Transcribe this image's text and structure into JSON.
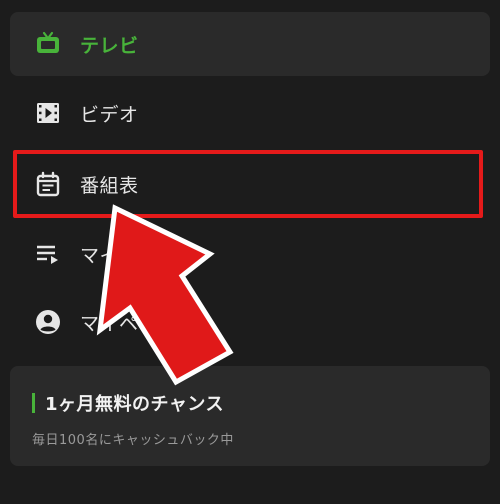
{
  "nav": {
    "items": [
      {
        "label": "テレビ",
        "icon": "tv-icon",
        "active": true
      },
      {
        "label": "ビデオ",
        "icon": "video-icon",
        "active": false
      },
      {
        "label": "番組表",
        "icon": "calendar-icon",
        "active": false
      },
      {
        "label": "マイリスト",
        "icon": "playlist-icon",
        "active": false
      },
      {
        "label": "マイページ",
        "icon": "account-icon",
        "active": false
      }
    ]
  },
  "promo": {
    "title": "1ヶ月無料のチャンス",
    "subtitle": "毎日100名にキャッシュバック中"
  },
  "colors": {
    "background": "#1c1c1c",
    "card": "#2a2a2a",
    "accent_green": "#48b33a",
    "highlight_red": "#e51a1a"
  }
}
